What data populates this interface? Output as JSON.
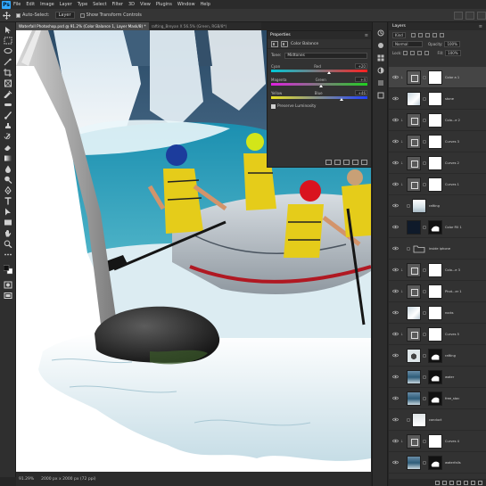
{
  "app": {
    "logo_text": "Ps",
    "menu": [
      "File",
      "Edit",
      "Image",
      "Layer",
      "Type",
      "Select",
      "Filter",
      "3D",
      "View",
      "Plugins",
      "Window",
      "Help"
    ]
  },
  "options": {
    "auto_select": "Auto-Select:",
    "layer_select": "Layer",
    "show_transform": "Show Transform Controls"
  },
  "tabs": [
    "Waterfall Photoshop.psd @ 91.2% (Color Balance 1, Layer Mask/8) *",
    "rafting_Breyan X 56.5% (Green, RGB/8*)"
  ],
  "status": {
    "zoom": "91.29%",
    "doc_info": "2000 px x 2000 px (72 ppi)"
  },
  "properties": {
    "tab_label": "Properties",
    "adjustment_name": "Color Balance",
    "tone_label": "Tone:",
    "tone_value": "Midtones",
    "sliders": [
      {
        "left": "Cyan",
        "right": "Red",
        "value": "+20",
        "gradient": [
          "#00c8d6",
          "#ff2020"
        ],
        "knob": 0.6
      },
      {
        "left": "Magenta",
        "right": "Green",
        "value": "+4",
        "gradient": [
          "#e020e0",
          "#20d020"
        ],
        "knob": 0.52
      },
      {
        "left": "Yellow",
        "right": "Blue",
        "value": "+46",
        "gradient": [
          "#e8e020",
          "#2040ff"
        ],
        "knob": 0.73
      }
    ],
    "preserve_label": "Preserve Luminosity"
  },
  "layers_panel": {
    "tab_label": "Layers",
    "kind_label": "Kind",
    "blend_mode": "Normal",
    "opacity_label": "Opacity:",
    "opacity_value": "100%",
    "lock_label": "Lock:",
    "fill_label": "Fill:",
    "fill_value": "100%",
    "layers": [
      {
        "name": "Color a 1",
        "thumb": "adj",
        "clip": true,
        "selected": true
      },
      {
        "name": "stone",
        "thumb": "img1",
        "clip": false,
        "selected": false
      },
      {
        "name": "Colo...e 2",
        "thumb": "adj",
        "clip": true,
        "selected": false
      },
      {
        "name": "Curves 3",
        "thumb": "adj",
        "clip": true,
        "selected": false
      },
      {
        "name": "Curves 2",
        "thumb": "adj",
        "clip": true,
        "selected": false
      },
      {
        "name": "Curves 1",
        "thumb": "adj",
        "clip": true,
        "selected": false
      },
      {
        "name": "rafting",
        "thumb": "img2",
        "clip": false,
        "selected": false
      },
      {
        "name": "Color Fill 1",
        "thumb": "dark",
        "clip": false,
        "selected": false
      },
      {
        "name": "inside iphone",
        "thumb": "none",
        "clip": false,
        "selected": false
      },
      {
        "name": "Colo...e 3",
        "thumb": "adj",
        "clip": true,
        "selected": false
      },
      {
        "name": "Phot...er 1",
        "thumb": "adj",
        "clip": true,
        "selected": false
      },
      {
        "name": "rocks",
        "thumb": "img1",
        "clip": false,
        "selected": false
      },
      {
        "name": "Curves 5",
        "thumb": "adj",
        "clip": true,
        "selected": false
      },
      {
        "name": "rafting",
        "thumb": "rock",
        "clip": false,
        "selected": false
      },
      {
        "name": "water",
        "thumb": "scene",
        "clip": false,
        "selected": false
      },
      {
        "name": "free_stac",
        "thumb": "scene",
        "clip": false,
        "selected": false
      },
      {
        "name": "conduct",
        "thumb": "stone",
        "clip": false,
        "selected": false
      },
      {
        "name": "Curves 4",
        "thumb": "adj",
        "clip": true,
        "selected": false
      },
      {
        "name": "waterfalls",
        "thumb": "scene",
        "clip": false,
        "selected": false
      }
    ]
  },
  "colors": {
    "accent": "#31a8ff",
    "panel": "#323232",
    "toolbar": "#2f2f2f"
  }
}
